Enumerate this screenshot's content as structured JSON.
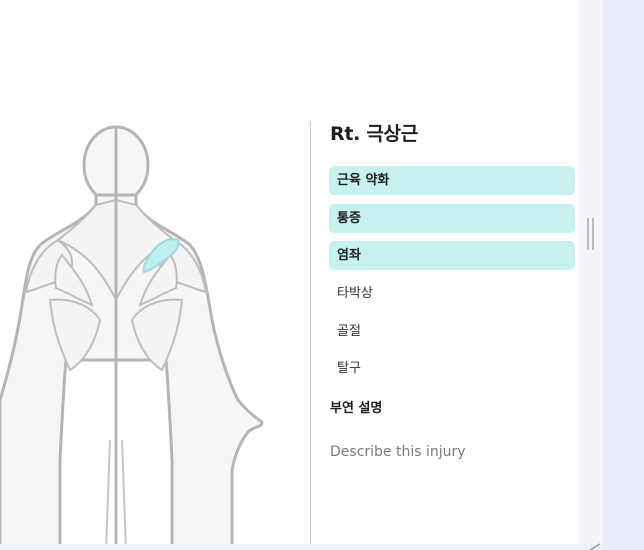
{
  "detail": {
    "title": "Rt. 극상근",
    "options": [
      {
        "label": "근육 약화",
        "selected": true
      },
      {
        "label": "통증",
        "selected": true
      },
      {
        "label": "염좌",
        "selected": true
      },
      {
        "label": "타박상",
        "selected": false
      },
      {
        "label": "골절",
        "selected": false
      },
      {
        "label": "탈구",
        "selected": false
      }
    ],
    "description_label": "부연 설명",
    "description_placeholder": "Describe this injury"
  },
  "colors": {
    "selected_bg": "#c6f1ef",
    "highlight_muscle": "#bfeef0",
    "outline": "#b5b5b5"
  }
}
